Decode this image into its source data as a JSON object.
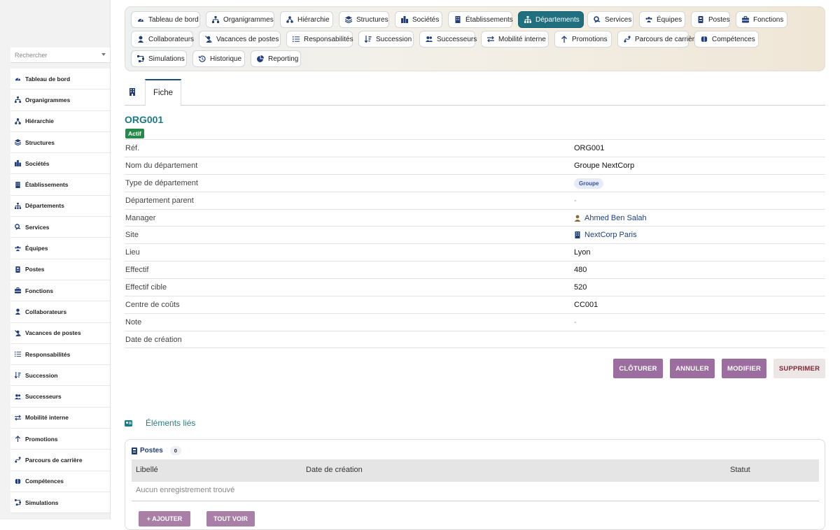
{
  "sidebar": {
    "search_placeholder": "Rechercher",
    "items": [
      {
        "label": "Tableau de bord",
        "icon": "dashboard-icon"
      },
      {
        "label": "Organigrammes",
        "icon": "org-chart-icon"
      },
      {
        "label": "Hiérarchie",
        "icon": "hierarchy-icon"
      },
      {
        "label": "Structures",
        "icon": "layers-icon"
      },
      {
        "label": "Sociétés",
        "icon": "city-icon"
      },
      {
        "label": "Établissements",
        "icon": "building-icon"
      },
      {
        "label": "Départements",
        "icon": "sitemap-icon"
      },
      {
        "label": "Services",
        "icon": "services-icon"
      },
      {
        "label": "Équipes",
        "icon": "team-icon"
      },
      {
        "label": "Postes",
        "icon": "badge-icon"
      },
      {
        "label": "Fonctions",
        "icon": "briefcase-icon"
      },
      {
        "label": "Collaborateurs",
        "icon": "user-icon"
      },
      {
        "label": "Vacances de postes",
        "icon": "user-slash-icon"
      },
      {
        "label": "Responsabilités",
        "icon": "list-icon"
      },
      {
        "label": "Succession",
        "icon": "sort-icon"
      },
      {
        "label": "Successeurs",
        "icon": "users-icon"
      },
      {
        "label": "Mobilité interne",
        "icon": "exchange-icon"
      },
      {
        "label": "Promotions",
        "icon": "arrow-up-icon"
      },
      {
        "label": "Parcours de carrière",
        "icon": "route-icon"
      },
      {
        "label": "Compétences",
        "icon": "brain-icon"
      },
      {
        "label": "Simulations",
        "icon": "flow-icon"
      }
    ]
  },
  "topnav": {
    "row1": [
      "Tableau de bord",
      "Organigrammes",
      "Hiérarchie",
      "Structures",
      "Sociétés",
      "Établissements",
      "Départements",
      "Services",
      "Équipes",
      "Postes",
      "Fonctions"
    ],
    "row2": [
      "Collaborateurs",
      "Vacances de postes",
      "Responsabilités",
      "Succession",
      "Successeurs",
      "Mobilité interne",
      "Promotions",
      "Parcours de carrière",
      "Compétences"
    ],
    "row3": [
      "Simulations",
      "Historique",
      "Reporting"
    ],
    "active": "Départements"
  },
  "tabs": {
    "fiche": "Fiche"
  },
  "record": {
    "code": "ORG001",
    "status": "Actif",
    "fields": [
      {
        "label": "Réf.",
        "value": "ORG001"
      },
      {
        "label": "Nom du département",
        "value": "Groupe NextCorp"
      },
      {
        "label": "Type de département",
        "value": "Groupe"
      },
      {
        "label": "Département parent",
        "value": "-"
      },
      {
        "label": "Manager",
        "value": "Ahmed Ben Salah"
      },
      {
        "label": "Site",
        "value": "NextCorp Paris"
      },
      {
        "label": "Lieu",
        "value": "Lyon"
      },
      {
        "label": "Effectif",
        "value": "480"
      },
      {
        "label": "Effectif cible",
        "value": "520"
      },
      {
        "label": "Centre de coûts",
        "value": "CC001"
      },
      {
        "label": "Note",
        "value": "-"
      },
      {
        "label": "Date de création",
        "value": ""
      }
    ]
  },
  "actions": {
    "close": "CLÔTURER",
    "cancel": "ANNULER",
    "edit": "MODIFIER",
    "delete": "SUPPRIMER"
  },
  "linked": {
    "title": "Éléments liés",
    "postes": {
      "title": "Postes",
      "count": "0",
      "columns": [
        "Libellé",
        "Date de création",
        "Statut"
      ],
      "empty": "Aucun enregistrement trouvé",
      "add": "+ AJOUTER",
      "all": "TOUT VOIR"
    }
  },
  "colors": {
    "accent": "#1f6f7f",
    "active_badge": "#258a48",
    "action_purple": "#9c6e9f",
    "link": "#1f3e7a"
  }
}
